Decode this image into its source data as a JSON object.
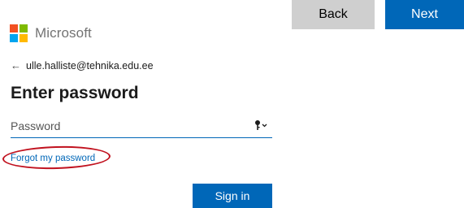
{
  "wizard": {
    "back_label": "Back",
    "next_label": "Next"
  },
  "brand": {
    "name": "Microsoft",
    "logo_colors": [
      "#f25022",
      "#7fba00",
      "#00a4ef",
      "#ffb900"
    ],
    "icon": "microsoft-logo"
  },
  "identity": {
    "back_icon": "left-arrow-icon",
    "back_glyph": "←",
    "email": "ulle.halliste@tehnika.edu.ee"
  },
  "form": {
    "title": "Enter password",
    "password_placeholder": "Password",
    "password_value": "",
    "reveal_icon": "key-dropdown-icon",
    "forgot_link": "Forgot my password",
    "signin_label": "Sign in"
  },
  "colors": {
    "primary": "#0067b8",
    "secondary_button": "#cfcfcf",
    "annotation": "#c1121f"
  }
}
